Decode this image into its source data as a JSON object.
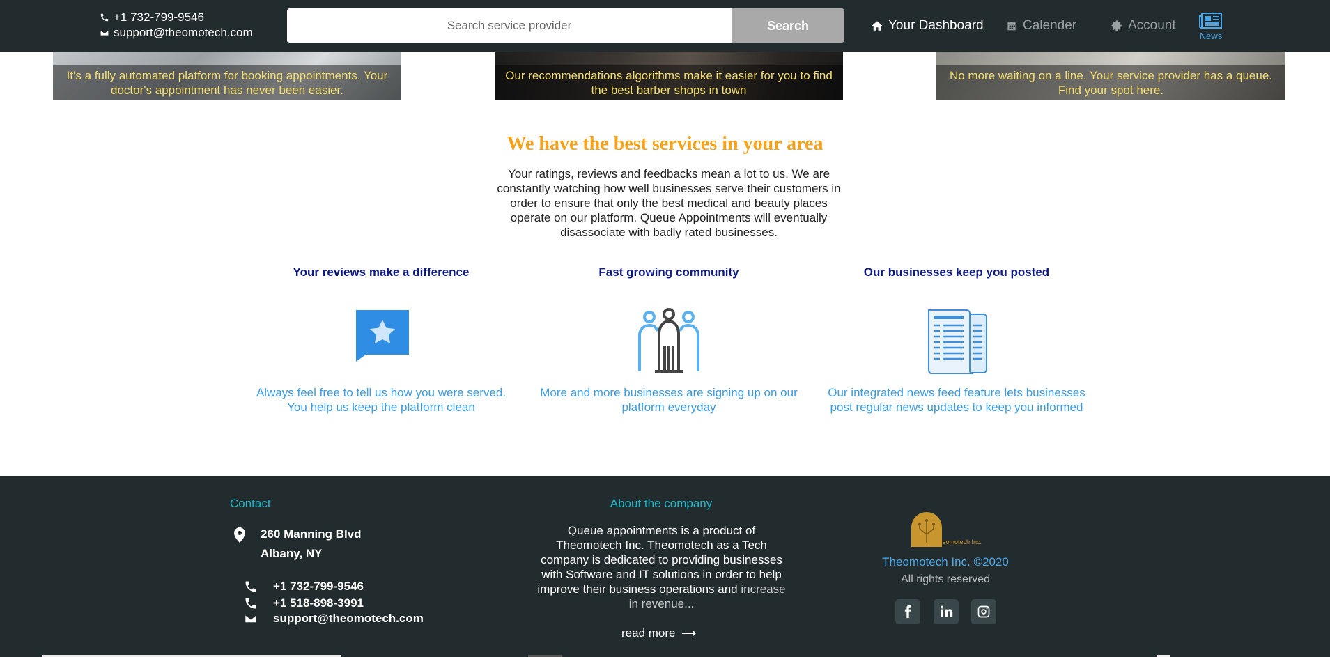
{
  "header": {
    "phone": "+1 732-799-9546",
    "email": "support@theomotech.com",
    "search": {
      "placeholder": "Search service provider",
      "button_label": "Search"
    },
    "nav": {
      "dashboard": "Your Dashboard",
      "calendar": "Calender",
      "account": "Account",
      "news": "News"
    }
  },
  "banners": [
    {
      "caption": "It's a fully automated platform for booking appointments. Your doctor's appointment has never been easier."
    },
    {
      "caption": "Our recommendations algorithms make it easier for you to find the best barber shops in town"
    },
    {
      "caption": "No more waiting on a line. Your service provider has a queue. Find your spot here."
    }
  ],
  "services": {
    "heading": "We have the best services in your area",
    "intro": "Your ratings, reviews and feedbacks mean a lot to us. We are constantly watching how well businesses serve their customers in order to ensure that only the best medical and beauty places operate on our platform. Queue Appointments will eventually disassociate with badly rated businesses.",
    "features": [
      {
        "title": "Your reviews make a difference",
        "icon": "star-review-icon",
        "text": "Always feel free to tell us how you were served. You help us keep the platform clean"
      },
      {
        "title": "Fast growing community",
        "icon": "community-icon",
        "text": "More and more businesses are signing up on our platform everyday"
      },
      {
        "title": "Our businesses keep you posted",
        "icon": "newspaper-icon",
        "text": "Our integrated news feed feature lets businesses post regular news updates to keep you informed"
      }
    ]
  },
  "footer": {
    "contact_heading": "Contact",
    "address_line1": "260 Manning Blvd",
    "address_line2": "Albany, NY",
    "phone1": "+1 732-799-9546",
    "phone2": "+1 518-898-3991",
    "email": "support@theomotech.com",
    "about_heading": "About the company",
    "about_text": "Queue appointments is a product of Theomotech Inc. Theomotech as a Tech company is dedicated to providing businesses with Software and IT solutions in order to help improve their business operations and",
    "about_fade": "increase in revenue...",
    "read_more": "read more",
    "logo_text": "Theomotech Inc.",
    "company": "Theomotech Inc. ©2020",
    "rights": "All rights reserved",
    "social": [
      "facebook-icon",
      "linkedin-icon",
      "instagram-icon"
    ]
  },
  "colors": {
    "topbar_bg": "#222b2d",
    "heading_orange": "#f6a21a",
    "feature_title": "#0e1a86",
    "feature_text": "#3c9ce0",
    "footer_heading": "#1fb6c9",
    "caption_yellow": "#f5de6e"
  }
}
